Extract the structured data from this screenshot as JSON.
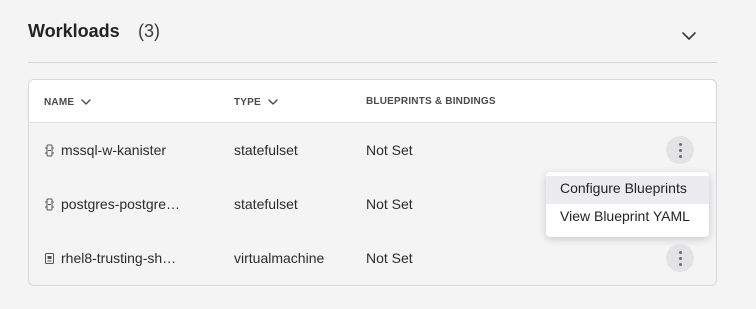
{
  "section": {
    "title": "Workloads",
    "count": "(3)"
  },
  "table": {
    "columns": [
      {
        "label": "NAME"
      },
      {
        "label": "TYPE"
      },
      {
        "label": "BLUEPRINTS & BINDINGS"
      }
    ],
    "rows": [
      {
        "name": "mssql-w-kanister",
        "type": "statefulset",
        "blueprints": "Not Set",
        "icon": "statefulset-icon"
      },
      {
        "name": "postgres-postgre…",
        "type": "statefulset",
        "blueprints": "Not Set",
        "icon": "statefulset-icon"
      },
      {
        "name": "rhel8-trusting-sh…",
        "type": "virtualmachine",
        "blueprints": "Not Set",
        "icon": "virtualmachine-icon"
      }
    ]
  },
  "context_menu": {
    "items": [
      {
        "label": "Configure Blueprints"
      },
      {
        "label": "View Blueprint YAML"
      }
    ]
  },
  "colors": {
    "page_bg": "#f4f4f5",
    "menu_hover": "#ececf0",
    "kebab_bg": "#e3e3e6"
  }
}
